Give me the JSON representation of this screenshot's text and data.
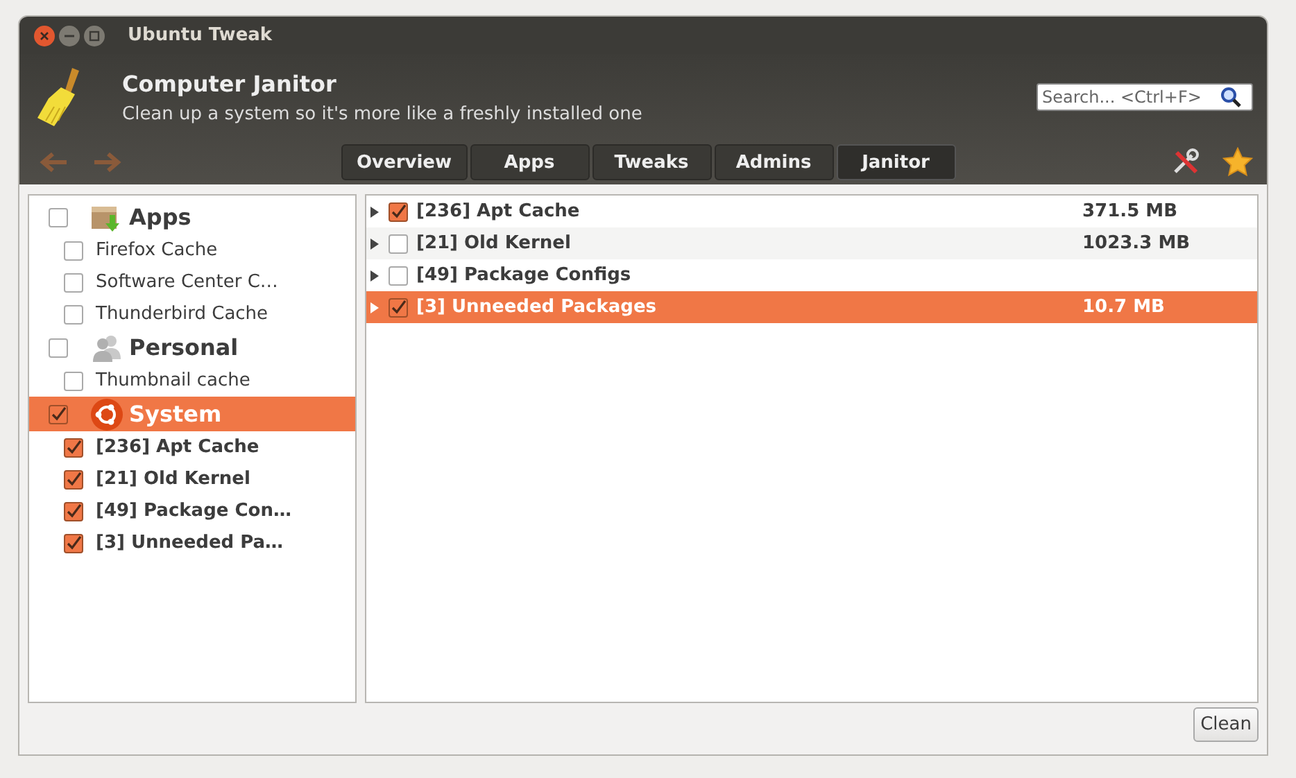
{
  "window": {
    "title": "Ubuntu Tweak"
  },
  "header": {
    "title": "Computer Janitor",
    "subtitle": "Clean up a system so it's more like a freshly installed one"
  },
  "search": {
    "placeholder": "Search... <Ctrl+F>"
  },
  "tabs": [
    {
      "label": "Overview",
      "selected": false
    },
    {
      "label": "Apps",
      "selected": false
    },
    {
      "label": "Tweaks",
      "selected": false
    },
    {
      "label": "Admins",
      "selected": false
    },
    {
      "label": "Janitor",
      "selected": true
    }
  ],
  "sidebar": {
    "categories": [
      {
        "label": "Apps",
        "kind": "apps",
        "checked": false,
        "selected": false,
        "children": [
          {
            "label": "Firefox Cache",
            "checked": false
          },
          {
            "label": "Software Center C…",
            "checked": false
          },
          {
            "label": "Thunderbird Cache",
            "checked": false
          }
        ]
      },
      {
        "label": "Personal",
        "kind": "personal",
        "checked": false,
        "selected": false,
        "children": [
          {
            "label": "Thumbnail cache",
            "checked": false
          }
        ]
      },
      {
        "label": "System",
        "kind": "system",
        "checked": true,
        "selected": true,
        "children": [
          {
            "label": "[236] Apt Cache",
            "checked": true
          },
          {
            "label": "[21] Old Kernel",
            "checked": true
          },
          {
            "label": "[49] Package Con…",
            "checked": true
          },
          {
            "label": "[3] Unneeded Pa…",
            "checked": true
          }
        ]
      }
    ]
  },
  "results": [
    {
      "label": "[236] Apt Cache",
      "size": "371.5 MB",
      "checked": true,
      "selected": false
    },
    {
      "label": "[21] Old Kernel",
      "size": "1023.3 MB",
      "checked": false,
      "selected": false
    },
    {
      "label": "[49] Package Configs",
      "checked": false,
      "selected": false
    },
    {
      "label": "[3] Unneeded Packages",
      "size": "10.7 MB",
      "checked": true,
      "selected": true
    }
  ],
  "buttons": [
    {
      "label": "Clean"
    }
  ]
}
